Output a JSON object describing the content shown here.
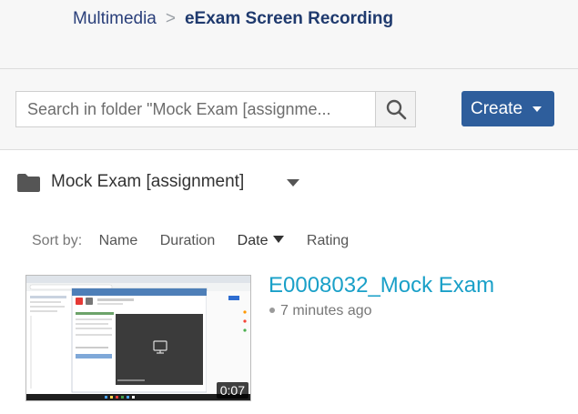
{
  "breadcrumb": {
    "parent": "Multimedia",
    "separator": ">",
    "current": "eExam Screen Recording"
  },
  "search": {
    "placeholder": "Search in folder \"Mock Exam [assignme..."
  },
  "create_button": {
    "label": "Create"
  },
  "folder": {
    "name": "Mock Exam [assignment]",
    "icon": "folder-icon"
  },
  "sort": {
    "label": "Sort by:",
    "options": [
      "Name",
      "Duration",
      "Date",
      "Rating"
    ],
    "active": "Date"
  },
  "media": [
    {
      "title": "E0008032_Mock Exam",
      "age": "7 minutes ago",
      "duration": "0:07"
    }
  ],
  "colors": {
    "accent": "#2e5e9c",
    "link": "#1aa0c8",
    "breadcrumb": "#1f3a6e"
  }
}
